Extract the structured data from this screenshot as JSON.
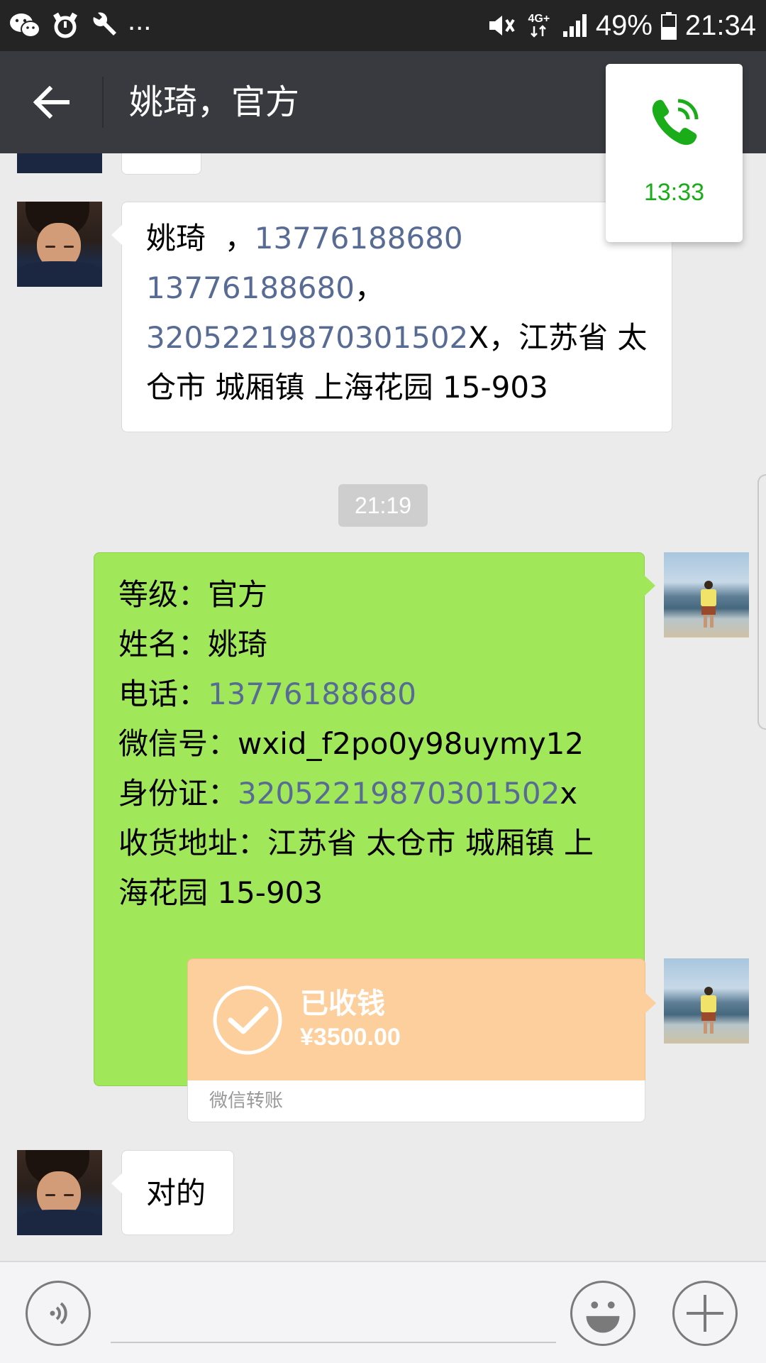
{
  "status_bar": {
    "ellipsis": "...",
    "network": "4G+",
    "battery": "49%",
    "time": "21:34",
    "icons": [
      "wechat-icon",
      "alarm-icon",
      "wrench-icon",
      "mute-icon",
      "signal-icon",
      "battery-icon"
    ]
  },
  "header": {
    "title": "姚琦，官方"
  },
  "call_card": {
    "time": "13:33",
    "icon": "phone-icon",
    "accent": "#1aad19"
  },
  "chat": {
    "incoming_1": {
      "name": "姚琦",
      "sep1": "  ，",
      "phone1": "13776188680",
      "phone2": "13776188680",
      "sep2": "，",
      "id_number": "320522198703015‌02",
      "id_number_plain": "320522198703015",
      "id_digits_tail": "02",
      "id_suffix": "X",
      "address_line1": "，江苏省 太",
      "address_line2": "仓市 城厢镇 上海花园 15-903"
    },
    "timestamp": "21:19",
    "outgoing_1": {
      "line1_label": "等级：",
      "line1_value": "官方",
      "line2_label": "姓名：",
      "line2_value": "姚琦",
      "line3_label": "电话：",
      "line3_value": "13776188680",
      "line4_label": "微信号：",
      "line4_value": "wxid_f2po0y98uymy12",
      "line5_label": "身份证：",
      "line5_value": "320522198703015",
      "line5_value_tail": "02",
      "line5_suffix": "x",
      "line6": "收货地址：江苏省 太仓市 城厢镇 上",
      "line7": "海花园 15-903"
    },
    "transfer": {
      "status": "已收钱",
      "amount": "¥3500.00",
      "label": "微信转账",
      "color": "#fdcf9d"
    },
    "incoming_2": {
      "text": "对的"
    }
  },
  "input_bar": {
    "voice_icon": "voice-icon",
    "emoji_icon": "emoji-icon",
    "plus_icon": "plus-icon",
    "placeholder": ""
  }
}
